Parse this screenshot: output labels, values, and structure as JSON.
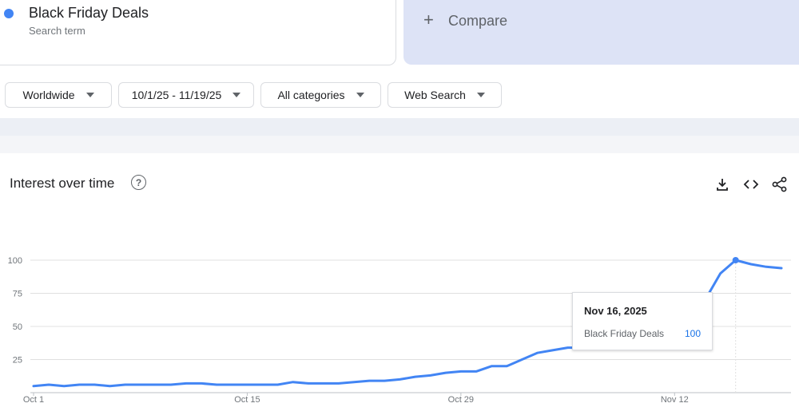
{
  "search_term": {
    "name": "Black Friday Deals",
    "subtitle": "Search term",
    "color": "#4285f4"
  },
  "compare": {
    "icon": "plus-icon",
    "label": "Compare"
  },
  "filters": [
    {
      "label": "Worldwide"
    },
    {
      "label": "10/1/25 - 11/19/25"
    },
    {
      "label": "All categories"
    },
    {
      "label": "Web Search"
    }
  ],
  "panel": {
    "title": "Interest over time",
    "help_icon": "help-circle-icon",
    "tools": [
      "download-icon",
      "embed-code-icon",
      "share-icon"
    ]
  },
  "tooltip": {
    "date": "Nov 16, 2025",
    "series": "Black Friday Deals",
    "value": "100"
  },
  "chart_data": {
    "type": "line",
    "x_tick_labels": [
      "Oct 1",
      "Oct 15",
      "Oct 29",
      "Nov 12"
    ],
    "y_tick_labels": [
      "25",
      "50",
      "75",
      "100"
    ],
    "ylim": [
      0,
      100
    ],
    "grid": true,
    "series": [
      {
        "name": "Black Friday Deals",
        "color": "#4285f4",
        "x": [
          "2025-10-01",
          "2025-10-02",
          "2025-10-03",
          "2025-10-04",
          "2025-10-05",
          "2025-10-06",
          "2025-10-07",
          "2025-10-08",
          "2025-10-09",
          "2025-10-10",
          "2025-10-11",
          "2025-10-12",
          "2025-10-13",
          "2025-10-14",
          "2025-10-15",
          "2025-10-16",
          "2025-10-17",
          "2025-10-18",
          "2025-10-19",
          "2025-10-20",
          "2025-10-21",
          "2025-10-22",
          "2025-10-23",
          "2025-10-24",
          "2025-10-25",
          "2025-10-26",
          "2025-10-27",
          "2025-10-28",
          "2025-10-29",
          "2025-10-30",
          "2025-10-31",
          "2025-11-01",
          "2025-11-02",
          "2025-11-03",
          "2025-11-04",
          "2025-11-05",
          "2025-11-06",
          "2025-11-07",
          "2025-11-08",
          "2025-11-09",
          "2025-11-10",
          "2025-11-11",
          "2025-11-12",
          "2025-11-13",
          "2025-11-14",
          "2025-11-15",
          "2025-11-16",
          "2025-11-17",
          "2025-11-18",
          "2025-11-19"
        ],
        "values": [
          5,
          6,
          5,
          6,
          6,
          5,
          6,
          6,
          6,
          6,
          7,
          7,
          6,
          6,
          6,
          6,
          6,
          8,
          7,
          7,
          7,
          8,
          9,
          9,
          10,
          12,
          13,
          15,
          16,
          16,
          20,
          20,
          25,
          30,
          32,
          34,
          34,
          37,
          40,
          43,
          48,
          55,
          65,
          60,
          70,
          90,
          100,
          97,
          95,
          94
        ]
      }
    ]
  }
}
